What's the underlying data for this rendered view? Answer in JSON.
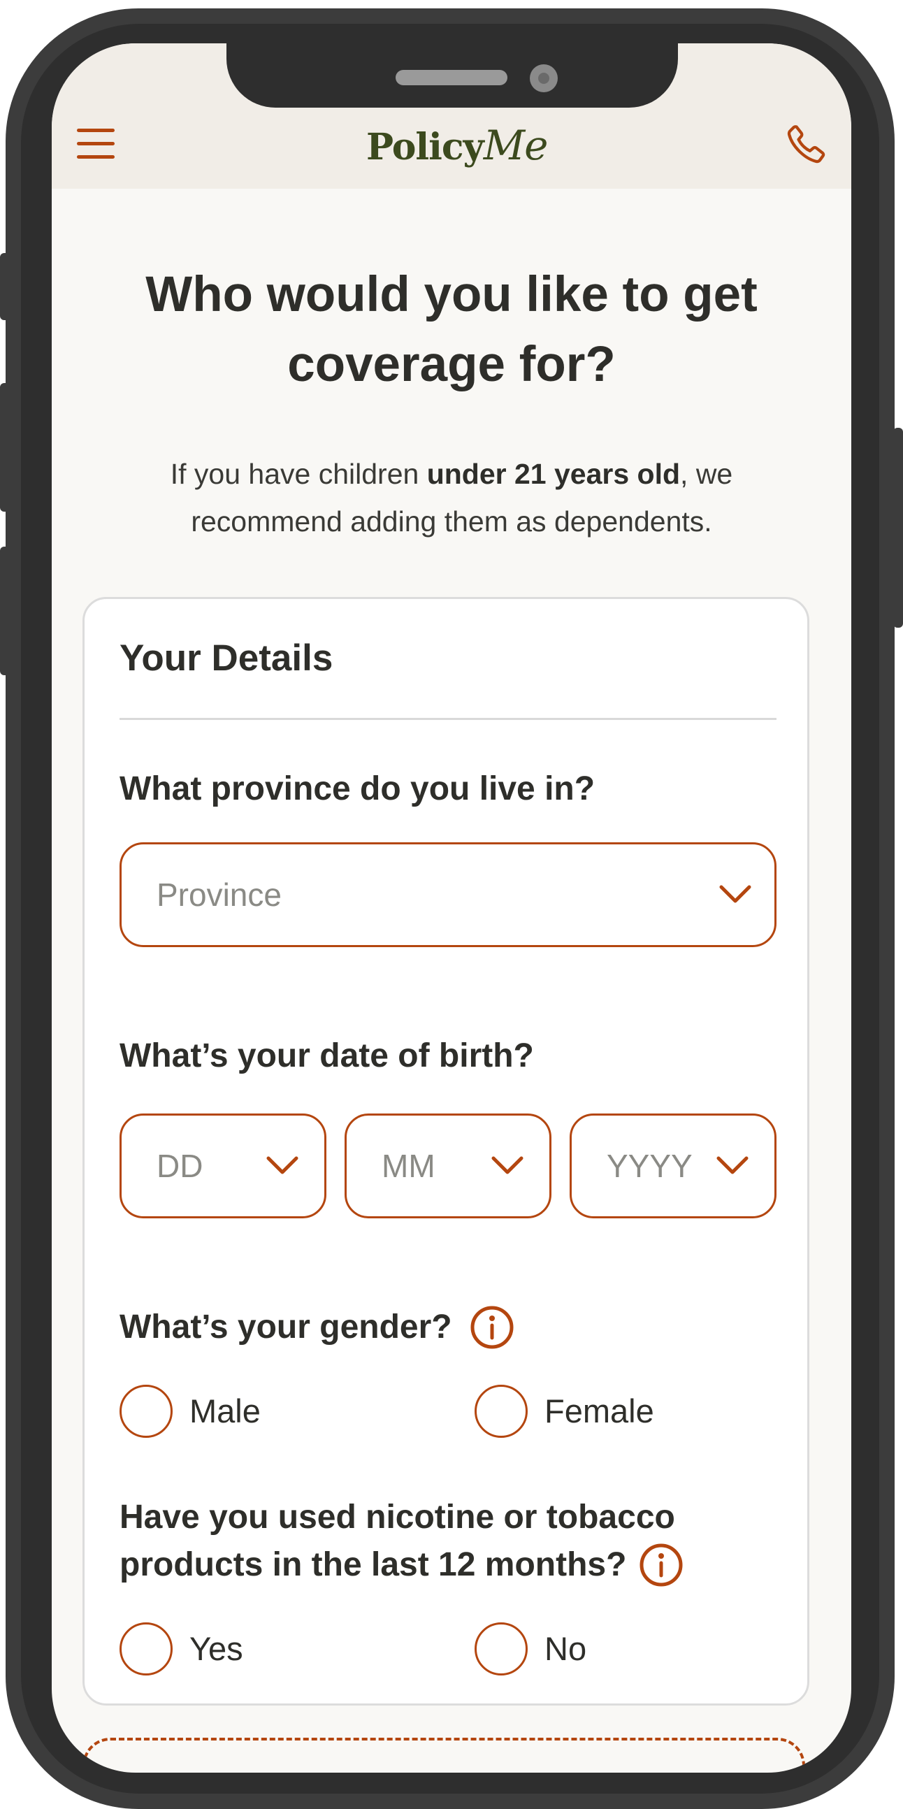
{
  "header": {
    "logo_main": "Policy",
    "logo_script": "Me"
  },
  "page": {
    "title": "Who would you like to get coverage for?",
    "subtitle_pre": "If you have children ",
    "subtitle_bold": "under 21 years old",
    "subtitle_post": ", we recommend adding them as dependents."
  },
  "card": {
    "title": "Your Details",
    "province": {
      "question": "What province do you live in?",
      "placeholder": "Province"
    },
    "dob": {
      "question": "What’s your date of birth?",
      "day_placeholder": "DD",
      "month_placeholder": "MM",
      "year_placeholder": "YYYY"
    },
    "gender": {
      "question": "What’s your gender?",
      "options": [
        "Male",
        "Female"
      ]
    },
    "nicotine": {
      "question": "Have you used nicotine or tobacco products in the last 12 months?",
      "options": [
        "Yes",
        "No"
      ]
    }
  },
  "colors": {
    "accent": "#b4460f",
    "logo": "#3c4a1e",
    "header_bg": "#f1ede7",
    "page_bg": "#f9f8f5",
    "text": "#2e2e2a"
  },
  "icons": [
    "hamburger-menu-icon",
    "phone-icon",
    "chevron-down-icon",
    "info-icon"
  ]
}
